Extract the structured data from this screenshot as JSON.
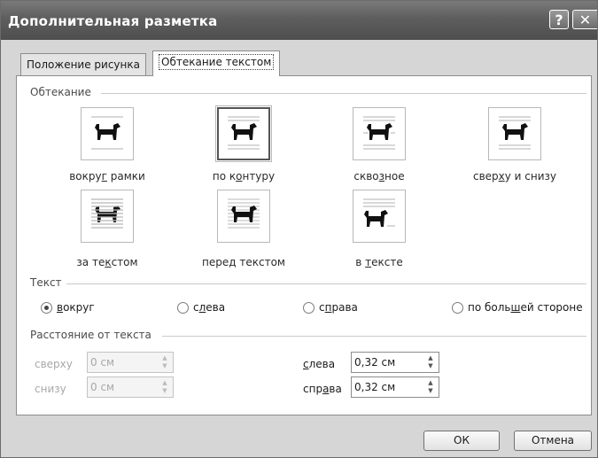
{
  "dialog": {
    "title": "Дополнительная разметка",
    "help_glyph": "?",
    "close_glyph": "✕"
  },
  "tabs": [
    {
      "label": "Положение рисунка",
      "active": false
    },
    {
      "label": "Обтекание текстом",
      "active": true
    }
  ],
  "wrapping": {
    "section_label": "Обтекание",
    "options": [
      {
        "pre": "вокру",
        "u": "г",
        "post": " рамки",
        "selected": false
      },
      {
        "pre": "по к",
        "u": "о",
        "post": "нтуру",
        "selected": true
      },
      {
        "pre": "скво",
        "u": "з",
        "post": "ное",
        "selected": false
      },
      {
        "pre": "свер",
        "u": "х",
        "post": "у и снизу",
        "selected": false
      },
      {
        "pre": "за те",
        "u": "к",
        "post": "стом",
        "selected": false
      },
      {
        "pre": "пере",
        "u": "д",
        "post": " текстом",
        "selected": false
      },
      {
        "pre": "в ",
        "u": "т",
        "post": "ексте",
        "selected": false
      }
    ]
  },
  "text": {
    "section_label": "Текст",
    "options": [
      {
        "pre": "",
        "u": "в",
        "post": "округ",
        "checked": true
      },
      {
        "pre": "с",
        "u": "л",
        "post": "ева",
        "checked": false
      },
      {
        "pre": "с",
        "u": "п",
        "post": "рава",
        "checked": false
      },
      {
        "pre": "по боль",
        "u": "ш",
        "post": "ей стороне",
        "checked": false
      }
    ]
  },
  "distance": {
    "section_label": "Расстояние от текста",
    "top": {
      "label": "сверху",
      "value": "0 см",
      "enabled": false
    },
    "bottom": {
      "label": "снизу",
      "value": "0 см",
      "enabled": false
    },
    "left": {
      "pre": "",
      "u": "с",
      "post": "лева",
      "value": "0,32 см",
      "enabled": true
    },
    "right": {
      "pre": "спр",
      "u": "а",
      "post": "ва",
      "value": "0,32 см",
      "enabled": true
    }
  },
  "buttons": {
    "ok": "ОК",
    "cancel": "Отмена"
  }
}
